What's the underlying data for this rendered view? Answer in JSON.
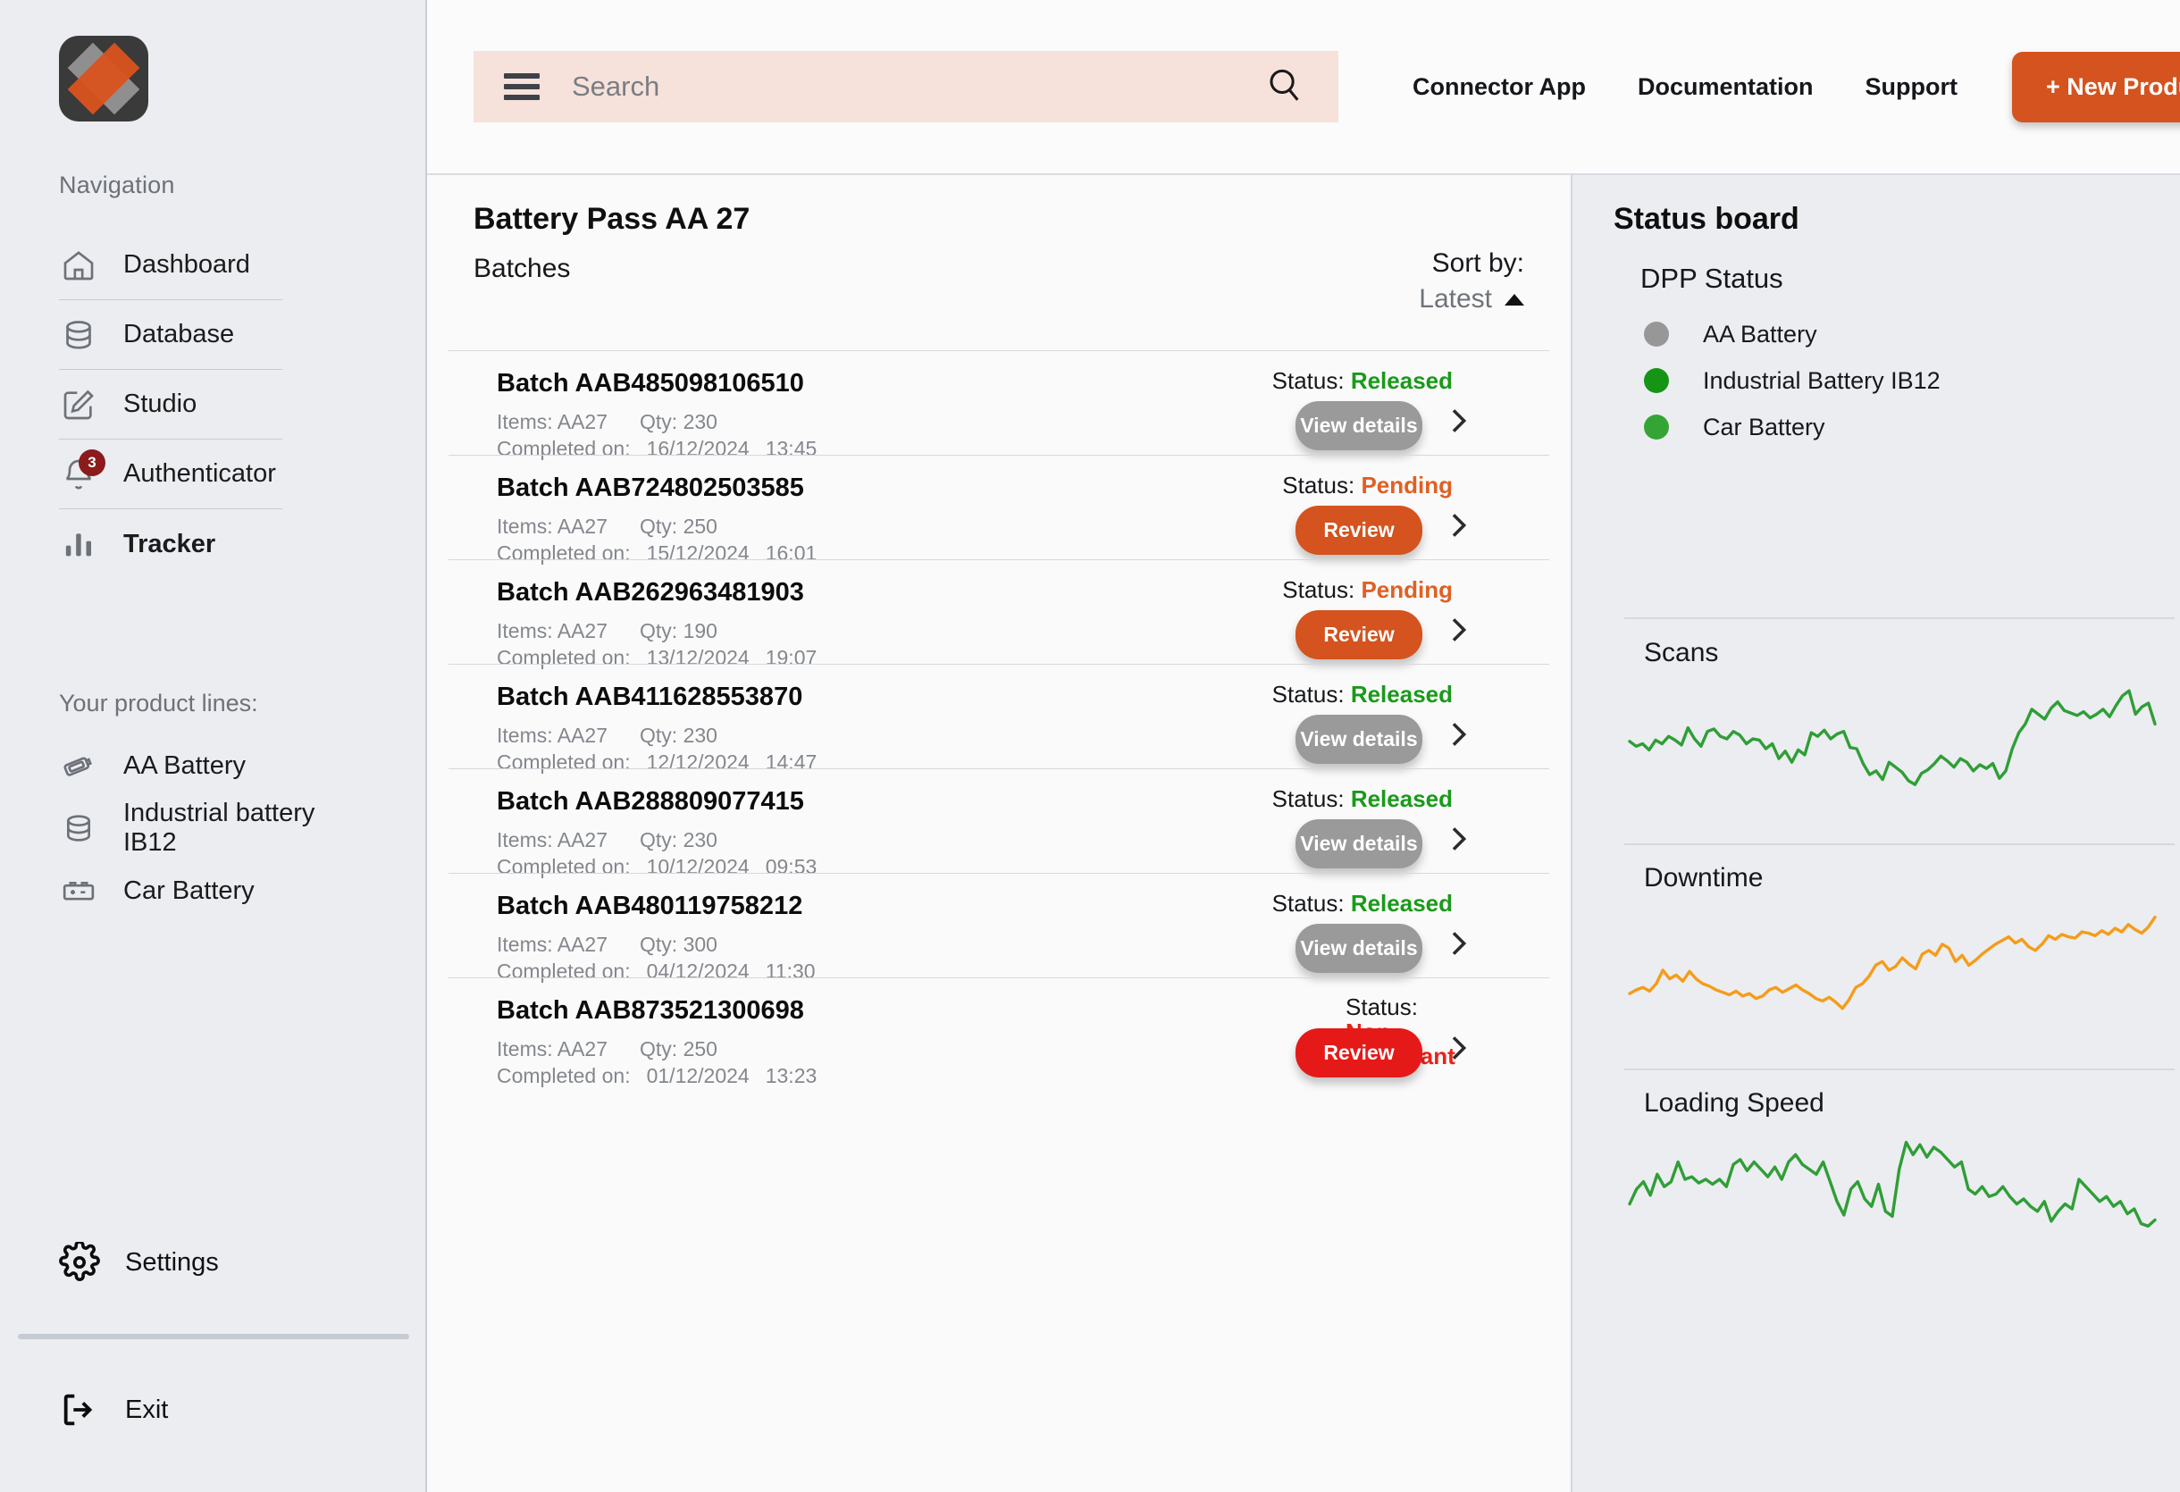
{
  "sidebar": {
    "logo_name": "app-logo",
    "nav_label": "Navigation",
    "nav_items": [
      {
        "label": "Dashboard",
        "icon": "home-icon",
        "active": false
      },
      {
        "label": "Database",
        "icon": "database-icon",
        "active": false
      },
      {
        "label": "Studio",
        "icon": "edit-square-icon",
        "active": false
      },
      {
        "label": "Authenticator",
        "icon": "bell-icon",
        "active": false,
        "badge": "3"
      },
      {
        "label": "Tracker",
        "icon": "bar-chart-icon",
        "active": true
      }
    ],
    "product_lines_label": "Your product lines:",
    "product_lines": [
      {
        "label": "AA Battery",
        "icon": "aa-battery-icon"
      },
      {
        "label": "Industrial battery IB12",
        "icon": "database-icon"
      },
      {
        "label": "Car Battery",
        "icon": "car-battery-icon"
      }
    ],
    "settings_label": "Settings",
    "exit_label": "Exit"
  },
  "topbar": {
    "search_placeholder": "Search",
    "menu_icon": "hamburger-icon",
    "search_icon": "search-icon",
    "links": [
      "Connector App",
      "Documentation",
      "Support"
    ],
    "new_product_label": "+ New Product"
  },
  "main": {
    "title": "Battery Pass AA 27",
    "subtitle": "Batches",
    "sort_label": "Sort by:",
    "sort_value": "Latest",
    "sort_direction_icon": "caret-up-icon",
    "status_prefix": "Status:",
    "items_label": "Items:",
    "qty_label": "Qty:",
    "completed_label": "Completed on:",
    "batches": [
      {
        "name": "Batch AAB485098106510",
        "items": "AA27",
        "qty": "230",
        "date": "16/12/2024",
        "time": "13:45",
        "status": "Released",
        "status_color": "#1a9a1a",
        "action": "View details",
        "action_style": "gray"
      },
      {
        "name": "Batch AAB724802503585",
        "items": "AA27",
        "qty": "250",
        "date": "15/12/2024",
        "time": "16:01",
        "status": "Pending",
        "status_color": "#e06024",
        "action": "Review",
        "action_style": "orange"
      },
      {
        "name": "Batch AAB262963481903",
        "items": "AA27",
        "qty": "190",
        "date": "13/12/2024",
        "time": "19:07",
        "status": "Pending",
        "status_color": "#e06024",
        "action": "Review",
        "action_style": "orange"
      },
      {
        "name": "Batch AAB411628553870",
        "items": "AA27",
        "qty": "230",
        "date": "12/12/2024",
        "time": "14:47",
        "status": "Released",
        "status_color": "#1a9a1a",
        "action": "View details",
        "action_style": "gray"
      },
      {
        "name": "Batch AAB288809077415",
        "items": "AA27",
        "qty": "230",
        "date": "10/12/2024",
        "time": "09:53",
        "status": "Released",
        "status_color": "#1a9a1a",
        "action": "View details",
        "action_style": "gray"
      },
      {
        "name": "Batch AAB480119758212",
        "items": "AA27",
        "qty": "300",
        "date": "04/12/2024",
        "time": "11:30",
        "status": "Released",
        "status_color": "#1a9a1a",
        "action": "View details",
        "action_style": "gray"
      },
      {
        "name": "Batch AAB873521300698",
        "items": "AA27",
        "qty": "250",
        "date": "01/12/2024",
        "time": "13:23",
        "status": "Non-compliant",
        "status_color": "#e8231a",
        "action": "Review",
        "action_style": "red"
      }
    ]
  },
  "status_board": {
    "title": "Status board",
    "dpp_title": "DPP Status",
    "dpp_items": [
      {
        "label": "AA Battery",
        "color": "#979797"
      },
      {
        "label": "Industrial Battery IB12",
        "color": "#169416"
      },
      {
        "label": "Car Battery",
        "color": "#34a534"
      }
    ]
  },
  "chart_data": [
    {
      "type": "line",
      "title": "Scans",
      "color": "#2f9e36",
      "xlabel": "",
      "ylabel": "",
      "x": [
        0,
        1,
        2,
        3,
        4,
        5,
        6,
        7,
        8,
        9,
        10,
        11,
        12,
        13,
        14,
        15,
        16,
        17,
        18,
        19,
        20,
        21,
        22,
        23,
        24,
        25,
        26,
        27,
        28,
        29,
        30,
        31,
        32,
        33,
        34,
        35,
        36,
        37,
        38,
        39,
        40,
        41,
        42,
        43,
        44,
        45,
        46,
        47,
        48,
        49,
        50,
        51,
        52,
        53,
        54,
        55,
        56,
        57,
        58,
        59,
        60,
        61,
        62,
        63,
        64,
        65,
        66,
        67,
        68,
        69,
        70,
        71,
        72,
        73,
        74,
        75,
        76,
        77,
        78,
        79
      ],
      "values": [
        48,
        44,
        46,
        41,
        49,
        46,
        52,
        49,
        45,
        59,
        50,
        44,
        56,
        58,
        52,
        50,
        56,
        53,
        46,
        50,
        49,
        42,
        46,
        34,
        40,
        31,
        41,
        37,
        55,
        52,
        57,
        50,
        54,
        56,
        43,
        42,
        30,
        21,
        24,
        17,
        31,
        27,
        23,
        16,
        13,
        22,
        25,
        30,
        36,
        32,
        27,
        34,
        31,
        24,
        29,
        26,
        30,
        18,
        24,
        42,
        55,
        62,
        74,
        70,
        66,
        75,
        80,
        73,
        71,
        69,
        72,
        67,
        70,
        74,
        68,
        77,
        85,
        89,
        70,
        76,
        79,
        62
      ],
      "ylim": [
        0,
        100
      ],
      "grid": false
    },
    {
      "type": "line",
      "title": "Downtime",
      "color": "#f59c1a",
      "xlabel": "",
      "ylabel": "",
      "x": [
        0,
        1,
        2,
        3,
        4,
        5,
        6,
        7,
        8,
        9,
        10,
        11,
        12,
        13,
        14,
        15,
        16,
        17,
        18,
        19,
        20,
        21,
        22,
        23,
        24,
        25,
        26,
        27,
        28,
        29,
        30,
        31,
        32,
        33,
        34,
        35,
        36,
        37,
        38,
        39,
        40,
        41,
        42,
        43,
        44,
        45,
        46,
        47,
        48,
        49,
        50,
        51,
        52,
        53,
        54,
        55,
        56,
        57,
        58,
        59,
        60,
        61,
        62,
        63,
        64,
        65,
        66,
        67,
        68,
        69,
        70,
        71,
        72,
        73,
        74,
        75,
        76,
        77,
        78,
        79
      ],
      "values": [
        26,
        29,
        31,
        28,
        34,
        45,
        38,
        41,
        36,
        44,
        38,
        34,
        32,
        29,
        27,
        25,
        28,
        24,
        26,
        22,
        24,
        29,
        31,
        27,
        30,
        33,
        29,
        26,
        22,
        20,
        23,
        19,
        14,
        21,
        31,
        34,
        40,
        49,
        52,
        45,
        48,
        55,
        50,
        46,
        58,
        61,
        57,
        66,
        63,
        52,
        57,
        49,
        53,
        58,
        62,
        66,
        69,
        72,
        67,
        70,
        64,
        61,
        66,
        73,
        70,
        74,
        72,
        71,
        76,
        75,
        73,
        77,
        74,
        79,
        76,
        82,
        78,
        75,
        80,
        88
      ],
      "ylim": [
        0,
        100
      ],
      "grid": false
    },
    {
      "type": "line",
      "title": "Loading Speed",
      "color": "#2f9e36",
      "xlabel": "",
      "ylabel": "",
      "x": [
        0,
        1,
        2,
        3,
        4,
        5,
        6,
        7,
        8,
        9,
        10,
        11,
        12,
        13,
        14,
        15,
        16,
        17,
        18,
        19,
        20,
        21,
        22,
        23,
        24,
        25,
        26,
        27,
        28,
        29,
        30,
        31,
        32,
        33,
        34,
        35,
        36,
        37,
        38,
        39,
        40,
        41,
        42,
        43,
        44,
        45,
        46,
        47,
        48,
        49,
        50,
        51,
        52,
        53,
        54,
        55,
        56,
        57,
        58,
        59,
        60,
        61,
        62,
        63,
        64,
        65,
        66,
        67,
        68,
        69,
        70,
        71,
        72,
        73,
        74,
        75,
        76,
        77,
        78,
        79
      ],
      "values": [
        38,
        50,
        56,
        45,
        62,
        52,
        56,
        72,
        58,
        60,
        55,
        58,
        54,
        58,
        52,
        70,
        74,
        65,
        72,
        66,
        60,
        68,
        58,
        72,
        78,
        70,
        66,
        62,
        72,
        56,
        40,
        29,
        50,
        56,
        42,
        36,
        54,
        32,
        28,
        66,
        88,
        78,
        86,
        76,
        84,
        80,
        74,
        68,
        72,
        50,
        46,
        52,
        44,
        46,
        52,
        44,
        38,
        42,
        36,
        32,
        40,
        24,
        32,
        38,
        34,
        58,
        52,
        46,
        40,
        44,
        36,
        40,
        30,
        34,
        22,
        20,
        25
      ],
      "ylim": [
        0,
        100
      ],
      "grid": false
    }
  ]
}
